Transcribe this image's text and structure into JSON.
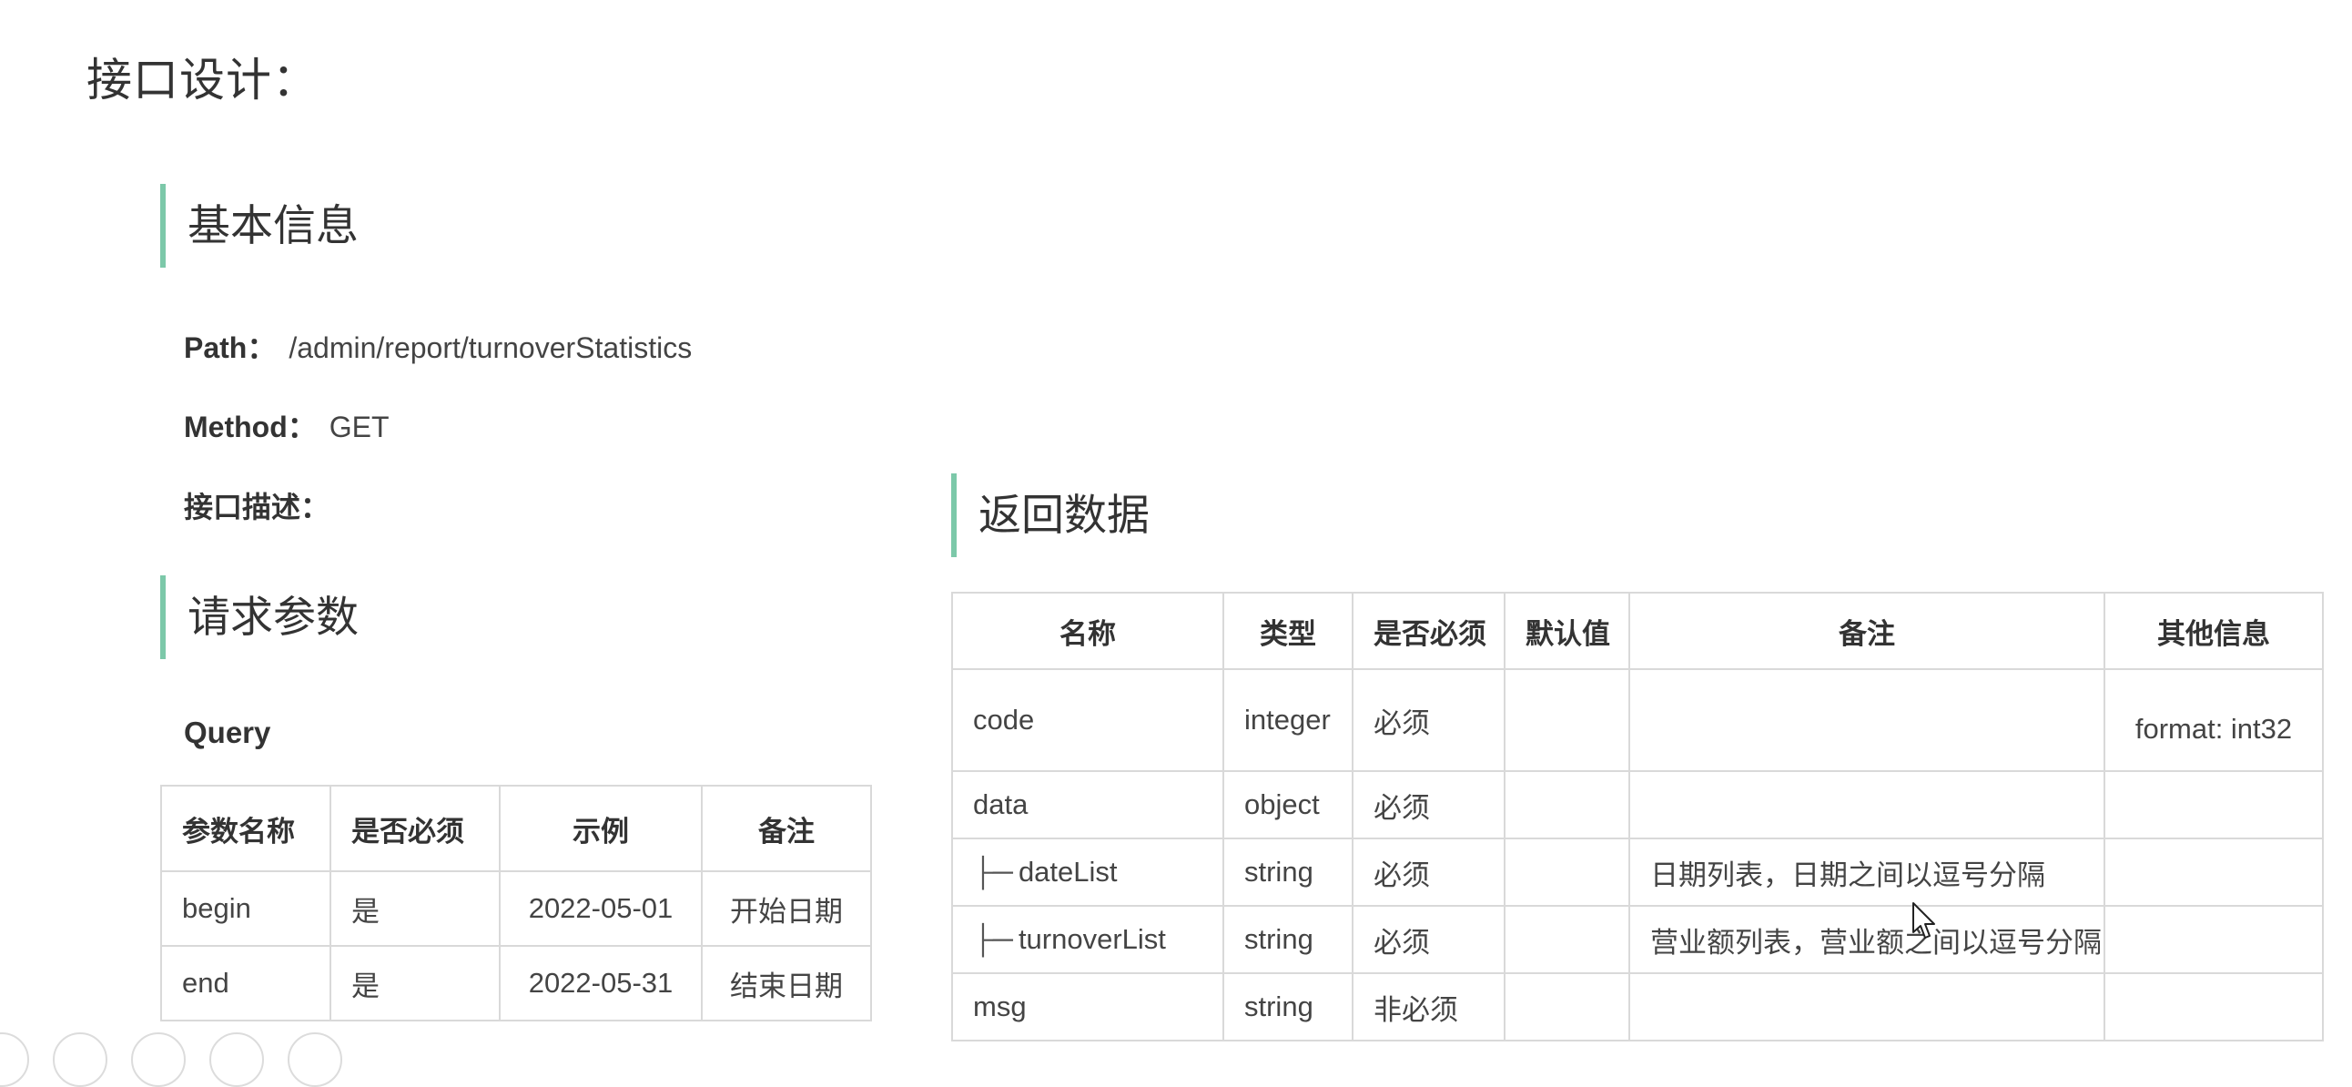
{
  "page_title": "接口设计：",
  "basic_info": {
    "heading": "基本信息",
    "path_label": "Path：",
    "path_value": "/admin/report/turnoverStatistics",
    "method_label": "Method：",
    "method_value": "GET",
    "desc_label": "接口描述："
  },
  "request": {
    "heading": "请求参数",
    "query_label": "Query",
    "columns": [
      "参数名称",
      "是否必须",
      "示例",
      "备注"
    ],
    "rows": [
      [
        "begin",
        "是",
        "2022-05-01",
        "开始日期"
      ],
      [
        "end",
        "是",
        "2022-05-31",
        "结束日期"
      ]
    ]
  },
  "response": {
    "heading": "返回数据",
    "columns": [
      "名称",
      "类型",
      "是否必须",
      "默认值",
      "备注",
      "其他信息"
    ],
    "tree_glyph": "├─",
    "rows": [
      [
        "code",
        "integer",
        "必须",
        "",
        "",
        "format: int32"
      ],
      [
        "data",
        "object",
        "必须",
        "",
        "",
        ""
      ],
      [
        "dateList",
        "string",
        "必须",
        "",
        "日期列表，日期之间以逗号分隔",
        ""
      ],
      [
        "turnoverList",
        "string",
        "必须",
        "",
        "营业额列表，营业额之间以逗号分隔",
        ""
      ],
      [
        "msg",
        "string",
        "非必须",
        "",
        "",
        ""
      ]
    ]
  },
  "colors": {
    "accent_bar": "#7cc8a9",
    "border": "#d9d9d9",
    "text": "#333333"
  }
}
